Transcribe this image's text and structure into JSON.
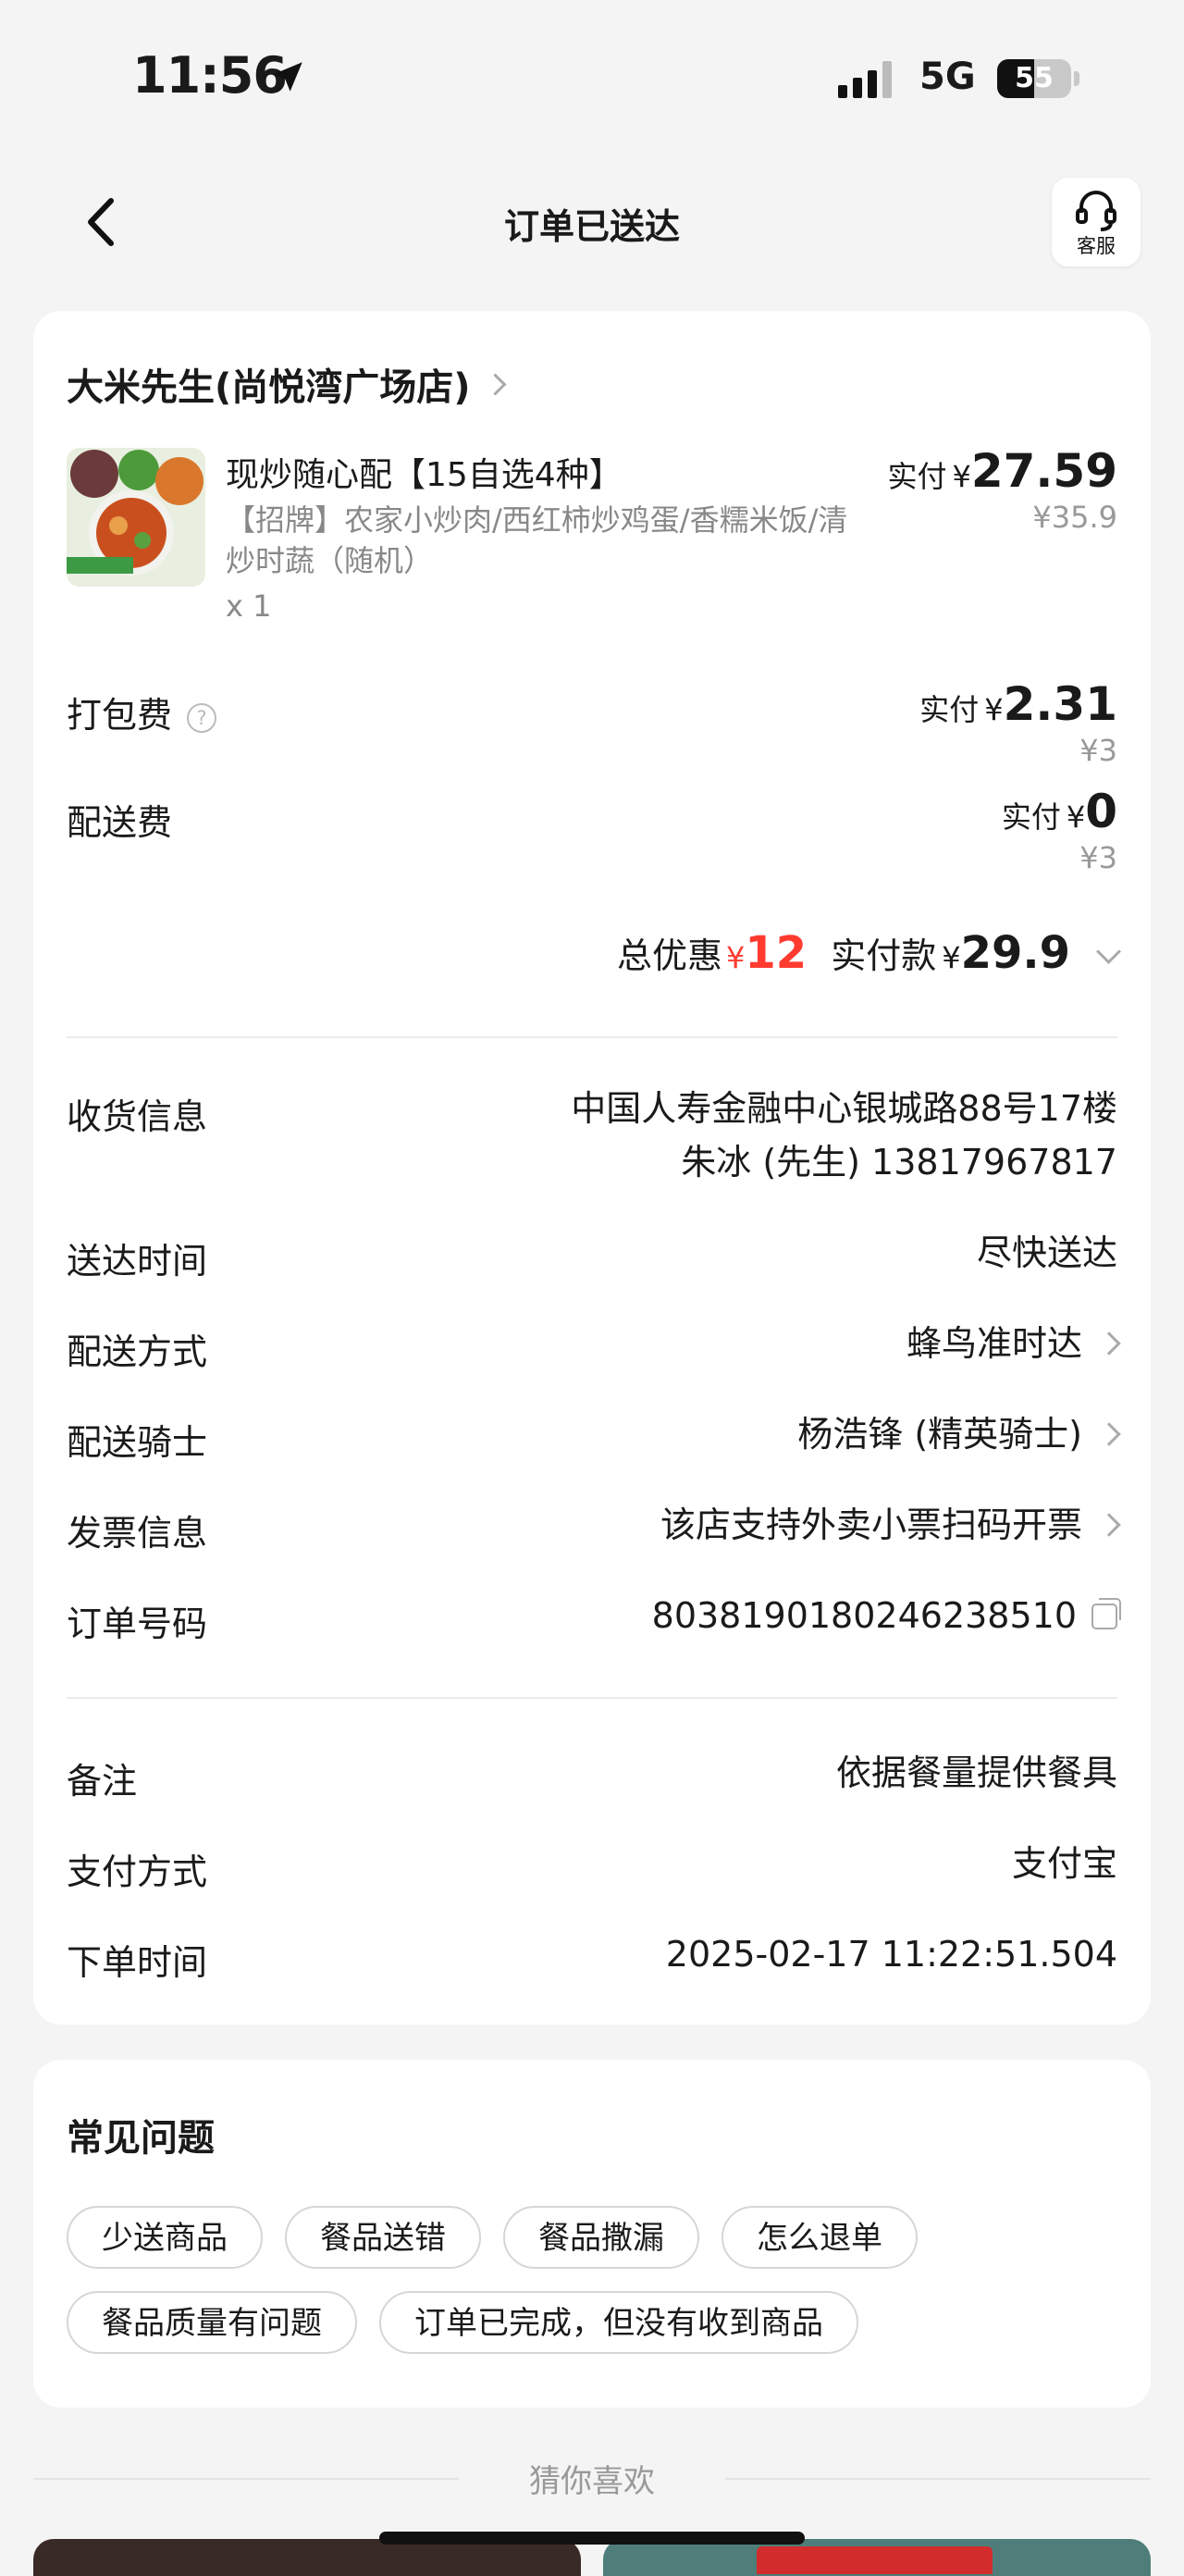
{
  "status_bar": {
    "time": "11:56",
    "network": "5G",
    "battery": "55"
  },
  "nav": {
    "title": "订单已送达",
    "service_label": "客服"
  },
  "order": {
    "shop_name": "大米先生(尚悦湾广场店)",
    "item": {
      "name": "现炒随心配【15自选4种】",
      "desc": "【招牌】农家小炒肉/西红柿炒鸡蛋/香糯米饭/清炒时蔬（随机）",
      "qty": "x 1",
      "paid_label": "实付",
      "yen": "¥",
      "paid": "27.59",
      "original": "¥35.9"
    },
    "packing": {
      "label": "打包费",
      "paid_label": "实付",
      "yen": "¥",
      "paid": "2.31",
      "original": "¥3"
    },
    "delivery_fee": {
      "label": "配送费",
      "paid_label": "实付",
      "yen": "¥",
      "paid": "0",
      "original": "¥3"
    },
    "totals": {
      "discount_label": "总优惠",
      "yen": "¥",
      "discount": "12",
      "paid_label": "实付款",
      "paid": "29.9"
    },
    "rows": {
      "address": {
        "label": "收货信息",
        "line1": "中国人寿金融中心银城路88号17楼",
        "line2": "朱冰 (先生) 13817967817"
      },
      "time": {
        "label": "送达时间",
        "value": "尽快送达"
      },
      "method": {
        "label": "配送方式",
        "value": "蜂鸟准时达"
      },
      "rider": {
        "label": "配送骑士",
        "value": "杨浩锋 (精英骑士)"
      },
      "invoice": {
        "label": "发票信息",
        "value": "该店支持外卖小票扫码开票"
      },
      "order_no": {
        "label": "订单号码",
        "value": "8038190180246238510"
      },
      "remark": {
        "label": "备注",
        "value": "依据餐量提供餐具"
      },
      "payment": {
        "label": "支付方式",
        "value": "支付宝"
      },
      "order_time": {
        "label": "下单时间",
        "value": "2025-02-17 11:22:51.504"
      }
    }
  },
  "faq": {
    "title": "常见问题",
    "chips": [
      "少送商品",
      "餐品送错",
      "餐品撒漏",
      "怎么退单",
      "餐品质量有问题",
      "订单已完成，但没有收到商品"
    ]
  },
  "recommend": {
    "title": "猜你喜欢"
  },
  "icons": {
    "back": "chevron-left-icon",
    "service": "headset-icon",
    "location": "location-arrow-icon",
    "copy": "copy-icon",
    "help": "question-circle-icon"
  },
  "colors": {
    "discount_red": "#ff3b30",
    "background": "#f4f4f4",
    "card": "#ffffff"
  }
}
